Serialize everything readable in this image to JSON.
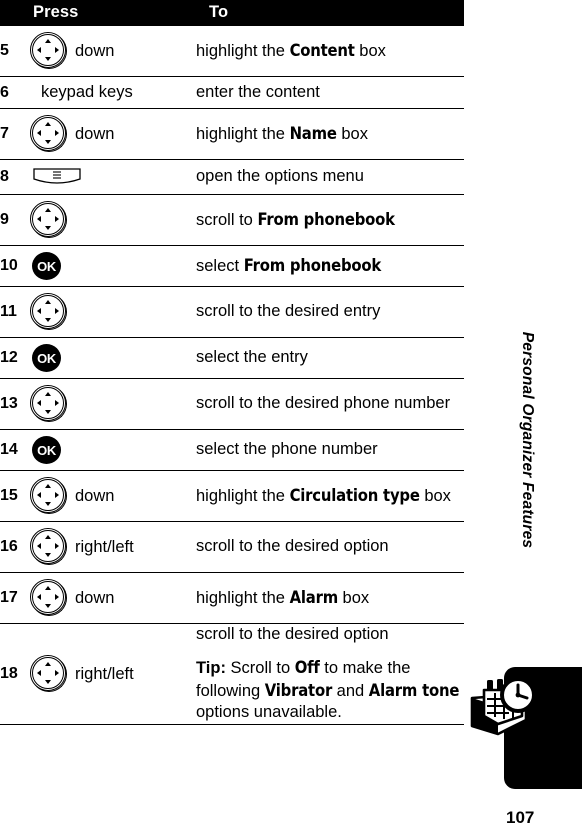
{
  "table": {
    "headers": {
      "num": "",
      "press": "Press",
      "to": "To"
    },
    "rows": [
      {
        "num": "5",
        "press_icon": "nav-key",
        "press_label": "down",
        "to_html": "highlight the <b class=\"term\">Content</b> box"
      },
      {
        "num": "6",
        "press_icon": "text",
        "press_label": "keypad keys",
        "to_html": "enter the content"
      },
      {
        "num": "7",
        "press_icon": "nav-key",
        "press_label": "down",
        "to_html": "highlight the <b class=\"term\">Name</b> box"
      },
      {
        "num": "8",
        "press_icon": "menu-key",
        "press_label": "",
        "to_html": "open the options menu"
      },
      {
        "num": "9",
        "press_icon": "nav-key",
        "press_label": "",
        "to_html": "scroll to <b class=\"term\">From phonebook</b>"
      },
      {
        "num": "10",
        "press_icon": "ok-key",
        "press_label": "",
        "to_html": "select <b class=\"term\">From phonebook</b>"
      },
      {
        "num": "11",
        "press_icon": "nav-key",
        "press_label": "",
        "to_html": "scroll to the desired entry"
      },
      {
        "num": "12",
        "press_icon": "ok-key",
        "press_label": "",
        "to_html": "select the entry"
      },
      {
        "num": "13",
        "press_icon": "nav-key",
        "press_label": "",
        "to_html": "scroll to the desired phone number"
      },
      {
        "num": "14",
        "press_icon": "ok-key",
        "press_label": "",
        "to_html": "select the phone number"
      },
      {
        "num": "15",
        "press_icon": "nav-key",
        "press_label": "down",
        "to_html": "highlight the <b class=\"term\">Circulation type</b> box"
      },
      {
        "num": "16",
        "press_icon": "nav-key",
        "press_label": "right/left",
        "to_html": "scroll to the desired option"
      },
      {
        "num": "17",
        "press_icon": "nav-key",
        "press_label": "down",
        "to_html": "highlight the <b class=\"term\">Alarm</b> box"
      },
      {
        "num": "18",
        "press_icon": "nav-key",
        "press_label": "right/left",
        "to_html": "scroll to the desired option<div class=\"tip-block\"><p><b class=\"tip\">Tip:</b> Scroll to <b class=\"term\">Off</b> to make the following <b class=\"term\">Vibrator</b> and <b class=\"term\">Alarm tone</b> options unavailable.</p></div>"
      }
    ]
  },
  "sidebar": {
    "chapter_title": "Personal Organizer Features",
    "chapter_icon": "calendar-clock-icon"
  },
  "footer": {
    "page_number": "107"
  },
  "colors": {
    "ink": "#000000",
    "paper": "#ffffff"
  }
}
